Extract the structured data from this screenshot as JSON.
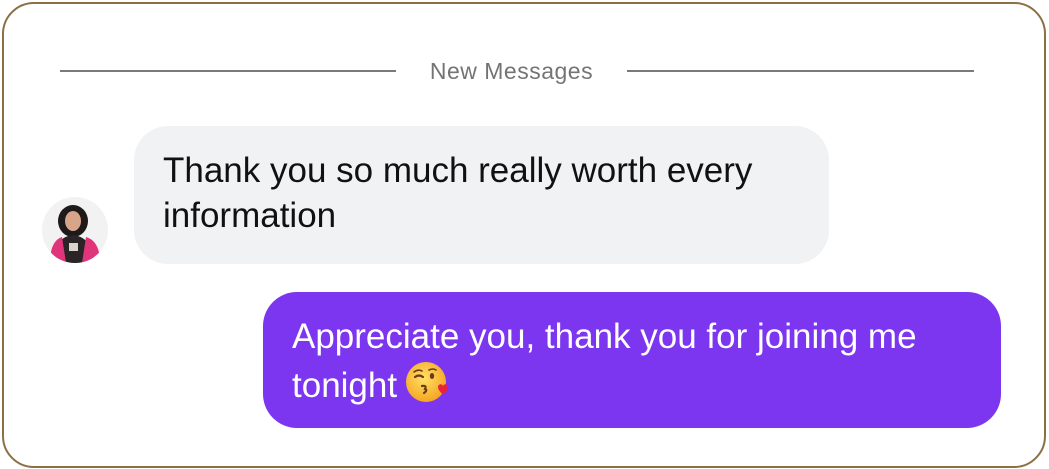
{
  "divider": {
    "label": "New Messages"
  },
  "messages": [
    {
      "direction": "incoming",
      "text": "Thank you so much really worth every information",
      "bubble_color": "#f1f2f4",
      "avatar_icon": "profile-avatar"
    },
    {
      "direction": "outgoing",
      "text": "Appreciate you, thank you for joining me tonight",
      "emoji": "face-blowing-a-kiss",
      "bubble_color": "#7d36f0"
    }
  ],
  "colors": {
    "frame_border": "#8c7045",
    "divider_text": "#747474",
    "outgoing_bubble": "#7d36f0",
    "incoming_bubble": "#f1f2f4"
  }
}
